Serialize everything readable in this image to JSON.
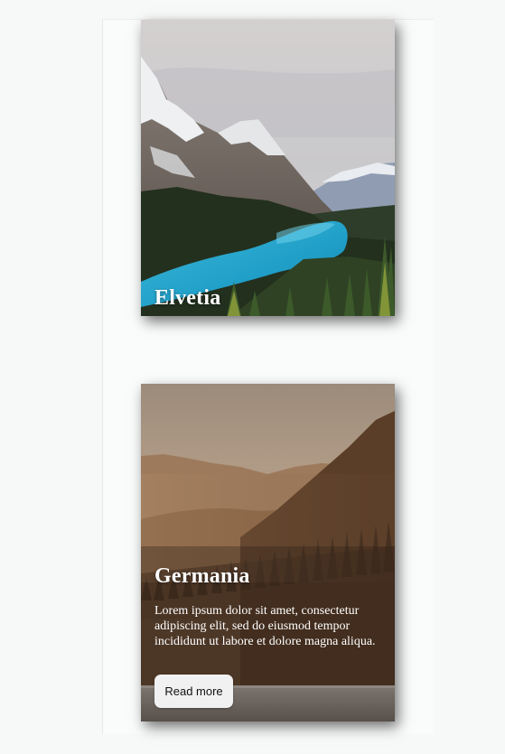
{
  "cards": [
    {
      "title": "Elvetia",
      "image": "mountain-lake-photo"
    },
    {
      "title": "Germania",
      "description": "Lorem ipsum dolor sit amet, consectetur adipiscing elit, sed do eiusmod tempor incididunt ut labore et dolore magna aliqua.",
      "button_label": "Read more",
      "image": "misty-forest-photo"
    }
  ],
  "colors": {
    "page_background": "#f7f8f8",
    "card_title": "#ffffff",
    "button_background": "#f1f1f1",
    "button_text": "#111111"
  }
}
